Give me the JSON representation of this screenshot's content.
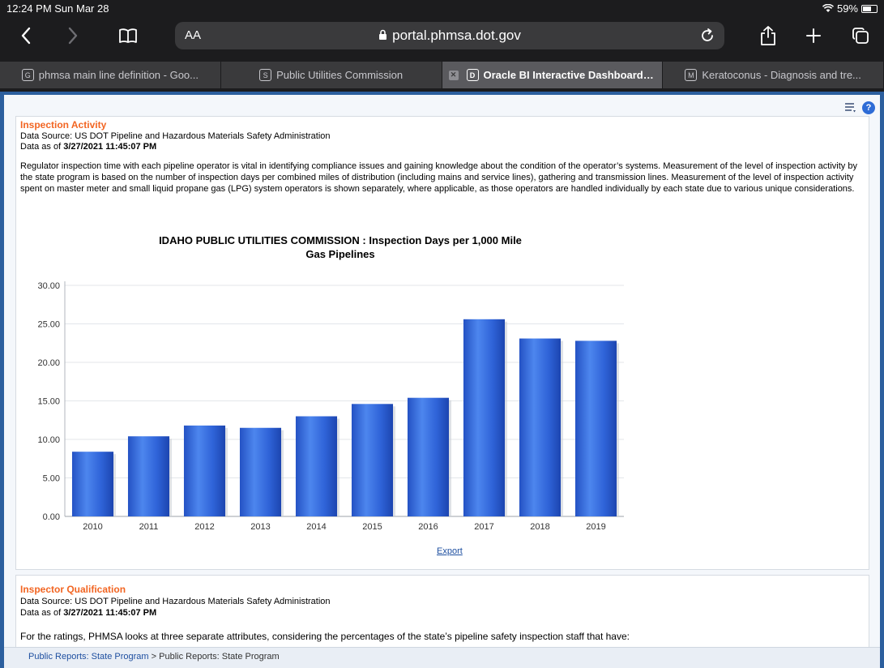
{
  "status": {
    "time": "12:24 PM  Sun Mar 28",
    "battery": "59%"
  },
  "toolbar": {
    "aa_label": "AA",
    "url": "portal.phmsa.dot.gov"
  },
  "tabs": [
    {
      "favicon": "G",
      "label": "phmsa main line definition - Goo...",
      "active": false
    },
    {
      "favicon": "S",
      "label": "Public Utilities Commission",
      "active": false
    },
    {
      "favicon": "D",
      "label": "Oracle BI Interactive Dashboards...",
      "active": true
    },
    {
      "favicon": "M",
      "label": "Keratoconus - Diagnosis and tre...",
      "active": false
    }
  ],
  "page_toolbar": {
    "help_label": "?"
  },
  "section1": {
    "title": "Inspection Activity",
    "source": "Data Source: US DOT Pipeline and Hazardous Materials Safety Administration",
    "asof_prefix": "Data as of ",
    "asof_value": "3/27/2021 11:45:07 PM",
    "para_line1": "Regulator inspection time with each pipeline operator is vital in identifying compliance issues and gaining knowledge about the condition of the operator’s systems. Measurement of the level of inspection activity by",
    "para_line2": "the state program is based on the number of inspection days per combined miles of distribution (including mains and service lines), gathering and transmission lines. Measurement of the level of inspection activity",
    "para_line3": "spent on master meter and small liquid propane gas (LPG) system operators is shown separately, where applicable, as those operators are handled individually by each state due to various unique considerations.",
    "export_label": "Export"
  },
  "section2": {
    "title": "Inspector Qualification",
    "source": "Data Source: US DOT Pipeline and Hazardous Materials Safety Administration",
    "asof_prefix": "Data as of ",
    "asof_value": "3/27/2021 11:45:07 PM",
    "para": "For the ratings, PHMSA looks at three separate attributes, considering the percentages of the state’s pipeline safety inspection staff that have:"
  },
  "footer": {
    "crumb1": "Public Reports: State Program",
    "sep": " > ",
    "crumb2": "Public Reports: State Program"
  },
  "chart_data": {
    "type": "bar",
    "title": "IDAHO PUBLIC UTILITIES COMMISSION : Inspection Days per 1,000 Mile",
    "subtitle": "Gas Pipelines",
    "categories": [
      "2010",
      "2011",
      "2012",
      "2013",
      "2014",
      "2015",
      "2016",
      "2017",
      "2018",
      "2019"
    ],
    "values": [
      8.4,
      10.4,
      11.8,
      11.5,
      13.0,
      14.6,
      15.4,
      25.6,
      23.1,
      22.8
    ],
    "yticks": [
      "0.00",
      "5.00",
      "10.00",
      "15.00",
      "20.00",
      "25.00",
      "30.00"
    ],
    "ylim": [
      0,
      30
    ],
    "grid": true,
    "legend": "none",
    "bar_color": "#2f63d8"
  }
}
